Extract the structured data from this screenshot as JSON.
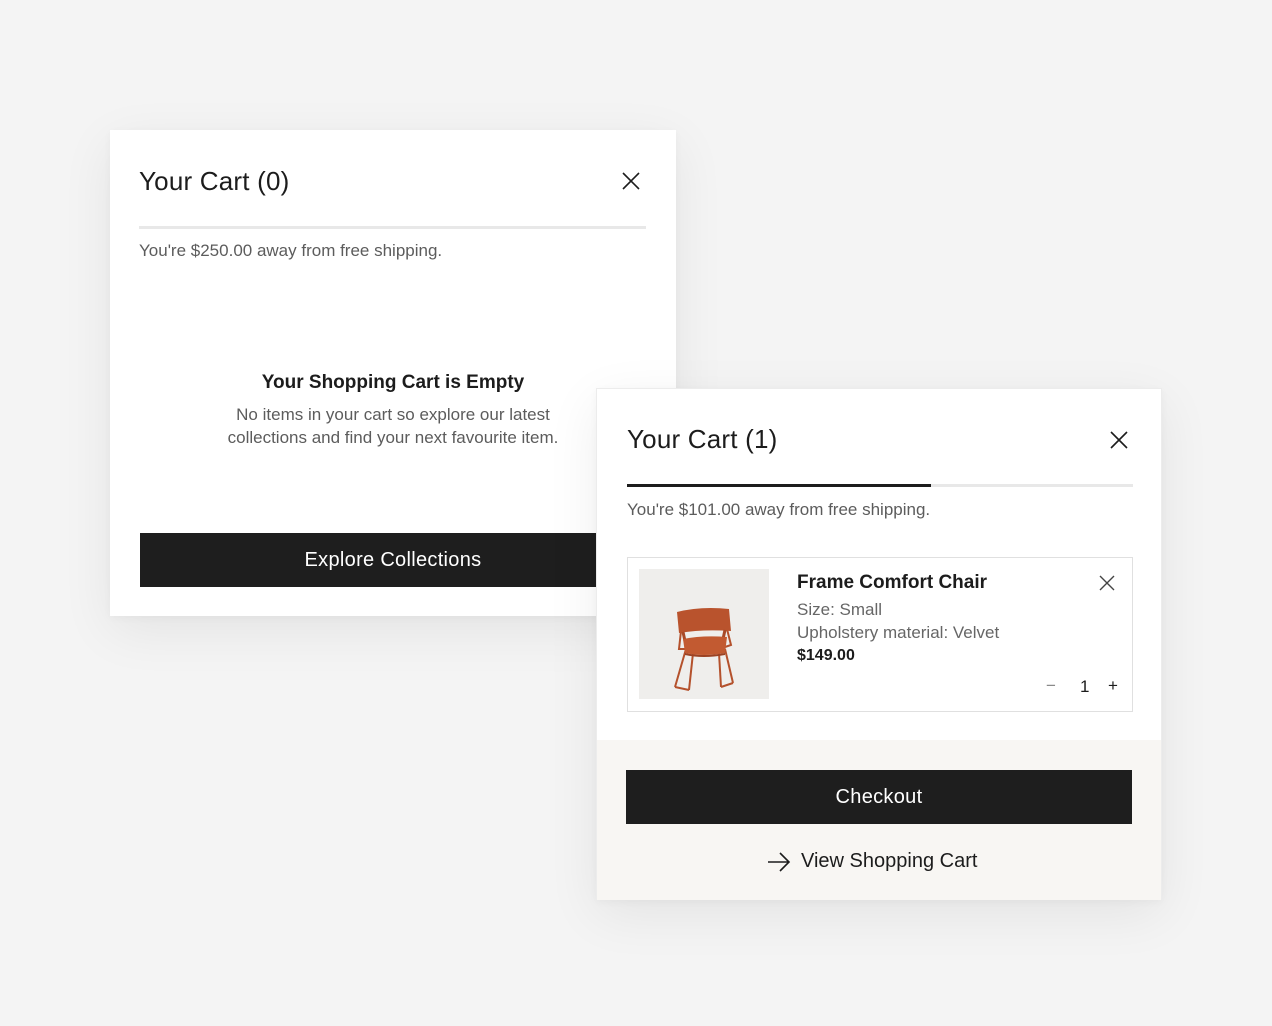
{
  "empty_cart": {
    "title": "Your Cart (0)",
    "close_label": "close",
    "shipping_message": "You're $250.00 away from free shipping.",
    "shipping_progress": 0,
    "empty_heading": "Your Shopping Cart is Empty",
    "empty_body": "No items in your cart so explore our latest collections and find your next favourite item.",
    "explore_button": "Explore Collections"
  },
  "filled_cart": {
    "title": "Your Cart (1)",
    "shipping_message": "You're $101.00 away from free shipping.",
    "shipping_progress": 0.6,
    "item": {
      "name": "Frame Comfort Chair",
      "size": "Size: Small",
      "material": "Upholstery material: Velvet",
      "price": "$149.00",
      "quantity": "1",
      "minus": "−",
      "plus": "+",
      "image": "chair-thumbnail"
    },
    "checkout_button": "Checkout",
    "view_cart_link": "View Shopping Cart"
  },
  "colors": {
    "page_bg": "#f4f4f4",
    "panel_bg": "#ffffff",
    "dark_button": "#1e1e1e",
    "footer_bg": "#f8f6f3",
    "chair": "#b4512c"
  },
  "icons": {
    "close": "close-icon",
    "arrow": "arrow-right-icon"
  }
}
